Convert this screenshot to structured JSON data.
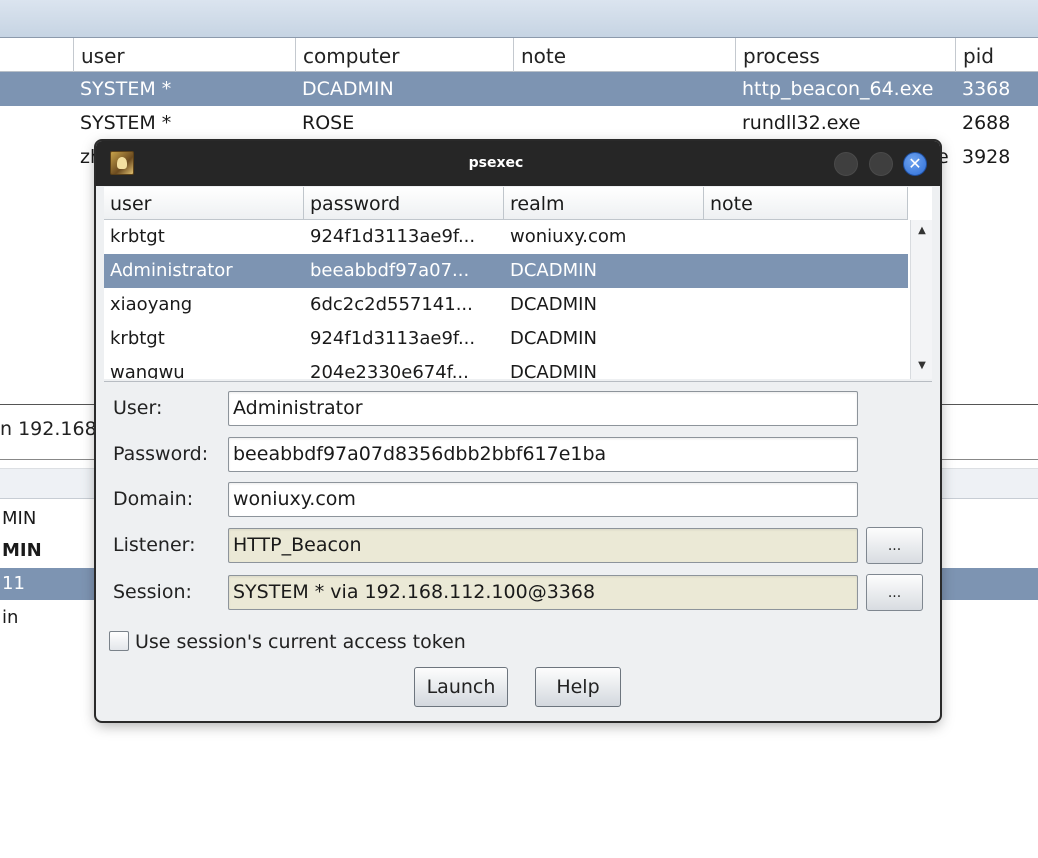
{
  "background_table": {
    "columns": [
      "user",
      "computer",
      "note",
      "process",
      "pid"
    ],
    "rows": [
      {
        "user": "SYSTEM *",
        "computer": "DCADMIN",
        "note": "",
        "process": "http_beacon_64.exe",
        "pid": "3368",
        "selected": true
      },
      {
        "user": "SYSTEM *",
        "computer": "ROSE",
        "note": "",
        "process": "rundll32.exe",
        "pid": "2688",
        "selected": false
      },
      {
        "user": "zh",
        "computer": "",
        "note": "",
        "process": "e",
        "pid": "3928",
        "selected": false
      }
    ]
  },
  "background_lower": {
    "tab_label": "n 192.168",
    "rows": [
      {
        "text": "MIN",
        "bold": false,
        "selected": false
      },
      {
        "text": "MIN",
        "bold": true,
        "selected": false
      },
      {
        "text": "11",
        "bold": false,
        "selected": true
      },
      {
        "text": "in",
        "bold": false,
        "selected": false
      }
    ]
  },
  "dialog": {
    "title": "psexec",
    "close_glyph": "✕",
    "table": {
      "columns": [
        "user",
        "password",
        "realm",
        "note"
      ],
      "rows": [
        {
          "user": "krbtgt",
          "password": "924f1d3113ae9f...",
          "realm": "woniuxy.com",
          "note": "",
          "selected": false
        },
        {
          "user": "Administrator",
          "password": "beeabbdf97a07...",
          "realm": "DCADMIN",
          "note": "",
          "selected": true
        },
        {
          "user": "xiaoyang",
          "password": "6dc2c2d557141...",
          "realm": "DCADMIN",
          "note": "",
          "selected": false
        },
        {
          "user": "krbtgt",
          "password": "924f1d3113ae9f...",
          "realm": "DCADMIN",
          "note": "",
          "selected": false
        },
        {
          "user": "wangwu",
          "password": "204e2330e674f...",
          "realm": "DCADMIN",
          "note": "",
          "selected": false
        }
      ],
      "scroll_up_glyph": "▲",
      "scroll_down_glyph": "▼"
    },
    "form": {
      "user_label": "User:",
      "user_value": "Administrator",
      "password_label": "Password:",
      "password_value": "beeabbdf97a07d8356dbb2bbf617e1ba",
      "domain_label": "Domain:",
      "domain_value": "woniuxy.com",
      "listener_label": "Listener:",
      "listener_value": "HTTP_Beacon",
      "session_label": "Session:",
      "session_value": "SYSTEM * via  192.168.112.100@3368",
      "browse_label": "...",
      "checkbox_label": "Use session's current access token",
      "checkbox_checked": false
    },
    "buttons": {
      "launch": "Launch",
      "help": "Help"
    }
  },
  "colors": {
    "selection": "#7d94b2",
    "titlebar": "#262626",
    "readonly_field": "#ebe9d6",
    "close_button": "#2f6fd8"
  }
}
